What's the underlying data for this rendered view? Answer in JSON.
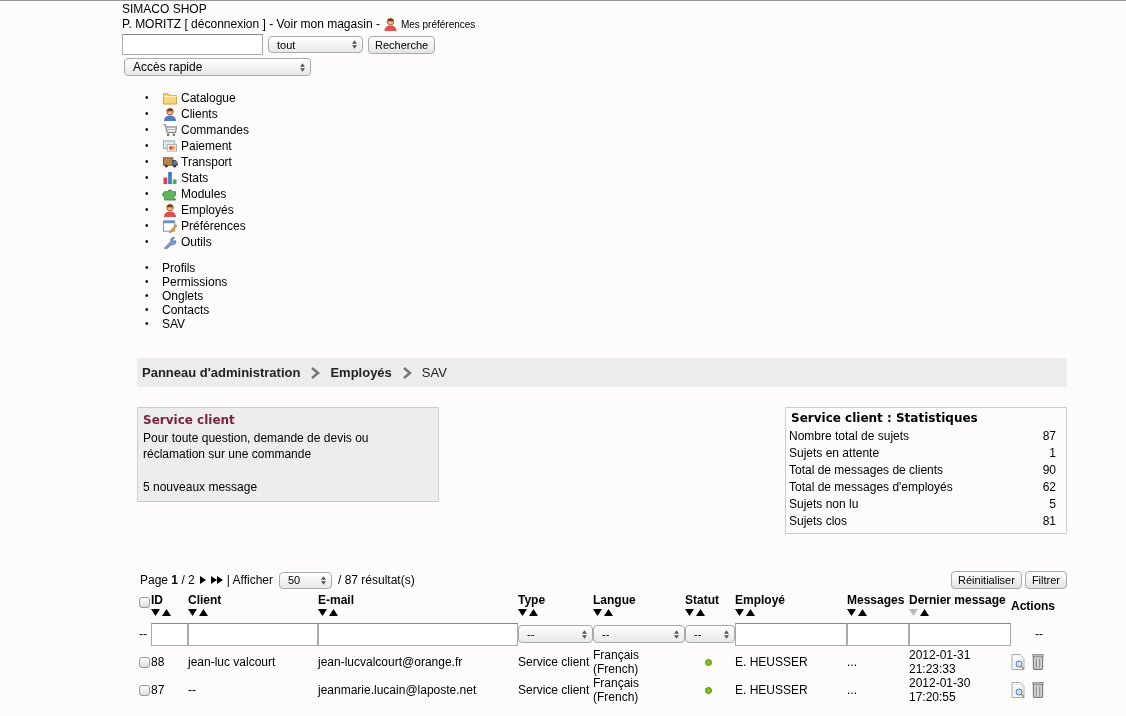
{
  "header": {
    "shop_name": "SIMACO SHOP",
    "user": "P. MORITZ [ déconnexion ] - Voir mon magasin -",
    "preferences_link": "Mes préférences",
    "search": {
      "scope": "tout",
      "button": "Recherche"
    },
    "quick_access": "Accès rapide"
  },
  "list_marker": "•",
  "menu": [
    {
      "label": "Catalogue"
    },
    {
      "label": "Clients"
    },
    {
      "label": "Commandes"
    },
    {
      "label": "Paiement"
    },
    {
      "label": "Transport"
    },
    {
      "label": "Stats"
    },
    {
      "label": "Modules"
    },
    {
      "label": "Employés"
    },
    {
      "label": "Préférences"
    },
    {
      "label": "Outils"
    }
  ],
  "submenu": [
    {
      "label": "Profils"
    },
    {
      "label": "Permissions"
    },
    {
      "label": "Onglets"
    },
    {
      "label": "Contacts"
    },
    {
      "label": "SAV"
    }
  ],
  "breadcrumb": [
    {
      "label": "Panneau d'administration",
      "current": false
    },
    {
      "label": "Employés",
      "current": false
    },
    {
      "label": "SAV",
      "current": true
    }
  ],
  "contact_box": {
    "title": "Service client",
    "description": "Pour toute question, demande de devis ou réclamation sur une commande",
    "new_messages": "5 nouveaux message"
  },
  "stats": {
    "title": "Service client : Statistiques",
    "rows": [
      {
        "label": "Nombre total de sujets",
        "value": "87"
      },
      {
        "label": "Sujets en attente",
        "value": "1"
      },
      {
        "label": "Total de messages de clients",
        "value": "90"
      },
      {
        "label": "Total de messages d'employés",
        "value": "62"
      },
      {
        "label": "Sujets non lu",
        "value": "5"
      },
      {
        "label": "Sujets clos",
        "value": "81"
      }
    ]
  },
  "pagination": {
    "page": "Page **1** / 2",
    "show": "| Afficher",
    "per_page": "50",
    "results": "/ 87 résultat(s)",
    "buttons": [
      "Réinitialiser",
      "Filtrer"
    ]
  },
  "table": {
    "select_all_checked": false,
    "checkbox_filter": "--",
    "columns": [
      {
        "label": "ID",
        "kind": "sortable",
        "sorted_desc": false,
        "filter": {
          "kind": "text"
        }
      },
      {
        "label": "Client",
        "kind": "sortable",
        "sorted_desc": false,
        "filter": {
          "kind": "text"
        }
      },
      {
        "label": "E-mail",
        "kind": "sortable",
        "sorted_desc": false,
        "filter": {
          "kind": "text"
        }
      },
      {
        "label": "Type",
        "kind": "sortable",
        "sorted_desc": false,
        "filter": {
          "kind": "select",
          "value": "--"
        }
      },
      {
        "label": "Langue",
        "kind": "sortable",
        "sorted_desc": false,
        "filter": {
          "kind": "select",
          "value": "--"
        }
      },
      {
        "label": "Statut",
        "kind": "sortable",
        "sorted_desc": false,
        "filter": {
          "kind": "select",
          "value": "--"
        }
      },
      {
        "label": "Employé",
        "kind": "sortable",
        "sorted_desc": false,
        "filter": {
          "kind": "text"
        }
      },
      {
        "label": "Messages",
        "kind": "sortable",
        "sorted_desc": false,
        "filter": {
          "kind": "text"
        }
      },
      {
        "label": "Dernier message",
        "kind": "sortable",
        "sorted_desc": true,
        "filter": {
          "kind": "text"
        }
      },
      {
        "label": "Actions",
        "kind": "plain",
        "filter": {
          "kind": "none",
          "value": "--"
        }
      }
    ],
    "rows": [
      {
        "checked": false,
        "cells": [
          "88",
          "jean-luc valcourt",
          "jean-lucvalcourt@orange.fr",
          "Service client",
          "Français (French)",
          {
            "kind": "status",
            "color": "#7cc520"
          },
          "E. HEUSSER",
          "...",
          "2012-01-31 21:23:33",
          {
            "kind": "actions"
          }
        ]
      },
      {
        "checked": false,
        "cells": [
          "87",
          "--",
          "jeanmarie.lucain@laposte.net",
          "Service client",
          "Français (French)",
          {
            "kind": "status",
            "color": "#7cc520"
          },
          "E. HEUSSER",
          "...",
          "2012-01-30 17:20:55",
          {
            "kind": "actions"
          }
        ]
      }
    ]
  }
}
